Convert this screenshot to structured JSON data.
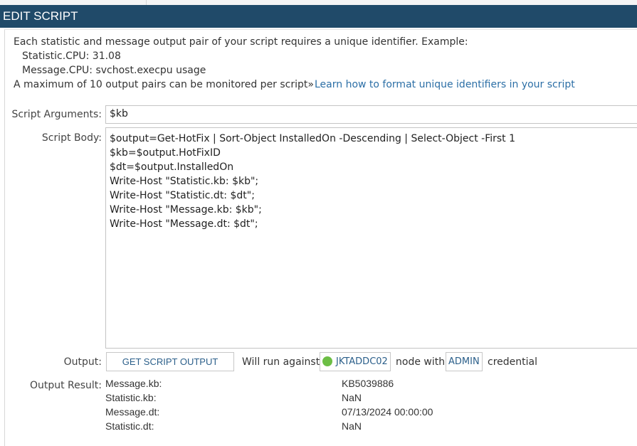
{
  "header": {
    "title": "EDIT SCRIPT"
  },
  "info": {
    "line1": "Each statistic and message output pair of your script requires a unique identifier. Example:",
    "example_statistic": "Statistic.CPU: 31.08",
    "example_message": "Message.CPU: svchost.execpu usage",
    "max_text": "A maximum of 10 output pairs can be monitored per script»",
    "learn_link": "Learn how to format unique identifiers in your script"
  },
  "form": {
    "args_label": "Script Arguments:",
    "args_value": "$kb",
    "body_label": "Script Body:",
    "body_lines": [
      "$output=Get-HotFix | Sort-Object InstalledOn -Descending | Select-Object -First 1",
      "$kb=$output.HotFixID",
      "$dt=$output.InstalledOn",
      "Write-Host \"Statistic.kb: $kb\";",
      "Write-Host \"Statistic.dt: $dt\";",
      "Write-Host \"Message.kb: $kb\";",
      "Write-Host \"Message.dt: $dt\";"
    ]
  },
  "output": {
    "label": "Output:",
    "button": "GET SCRIPT OUTPUT",
    "run_against": "Will run against",
    "node": "JKTADDC02",
    "node_with": "node with",
    "credential_name": "ADMIN",
    "credential_word": "credential",
    "node_status_color": "#6cbe45"
  },
  "result": {
    "label": "Output Result:",
    "rows": [
      {
        "key": "Message.kb:",
        "value": "KB5039886"
      },
      {
        "key": "Statistic.kb:",
        "value": "NaN"
      },
      {
        "key": "Message.dt:",
        "value": "07/13/2024 00:00:00"
      },
      {
        "key": "Statistic.dt:",
        "value": "NaN"
      }
    ]
  },
  "colors": {
    "header_bg": "#204a69",
    "link": "#2c6fa6"
  }
}
